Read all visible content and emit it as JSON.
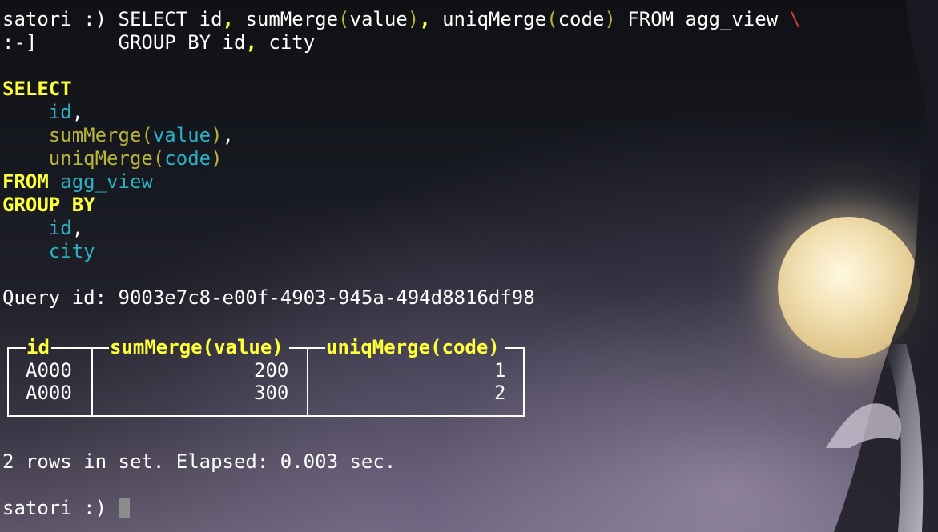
{
  "terminal": {
    "prompt": "satori :)",
    "continuation_prompt": ":-]",
    "command_line1": {
      "part1": "SELECT id",
      "comma1": ",",
      "part2": " sumMerge",
      "paren_open1": "(",
      "part3": "value",
      "paren_close1": ")",
      "comma2": ",",
      "part4": " uniqMerge",
      "paren_open2": "(",
      "part5": "code",
      "paren_close2": ")",
      "part6": " FROM agg_view ",
      "backslash": "\\"
    },
    "command_line2": {
      "part1": "GROUP BY id",
      "comma": ",",
      "part2": " city"
    },
    "formatted": {
      "select_kw": "SELECT",
      "col1": "id",
      "col1_sep": ",",
      "col2_fn": "sumMerge",
      "col2_open": "(",
      "col2_arg": "value",
      "col2_close": ")",
      "col2_sep": ",",
      "col3_fn": "uniqMerge",
      "col3_open": "(",
      "col3_arg": "code",
      "col3_close": ")",
      "from_kw": "FROM",
      "table": "agg_view",
      "group_kw": "GROUP BY",
      "g1": "id",
      "g1_sep": ",",
      "g2": "city"
    },
    "query_id": "Query id: 9003e7c8-e00f-4903-945a-494d8816df98",
    "result": {
      "headers": [
        "id",
        "sumMerge(value)",
        "uniqMerge(code)"
      ],
      "rows": [
        [
          "A000",
          "200",
          "1"
        ],
        [
          "A000",
          "300",
          "2"
        ]
      ]
    },
    "summary": "2 rows in set. Elapsed: 0.003 sec."
  }
}
